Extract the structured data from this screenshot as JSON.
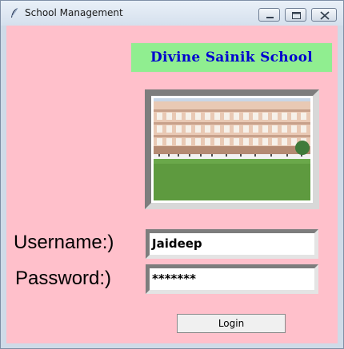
{
  "window": {
    "title": "School Management",
    "icon": "feather-icon"
  },
  "controls": {
    "minimize_icon": "minimize-icon",
    "maximize_icon": "maximize-icon",
    "close_icon": "close-icon"
  },
  "banner": {
    "school_name": "Divine Sainik School"
  },
  "form": {
    "username_label": "Username:)",
    "username_value": "Jaideep",
    "password_label": "Password:)",
    "password_value": "*******",
    "login_label": "Login"
  },
  "colors": {
    "background": "#ffc0cb",
    "banner_bg": "#90ee90",
    "banner_text": "#0000d0"
  }
}
